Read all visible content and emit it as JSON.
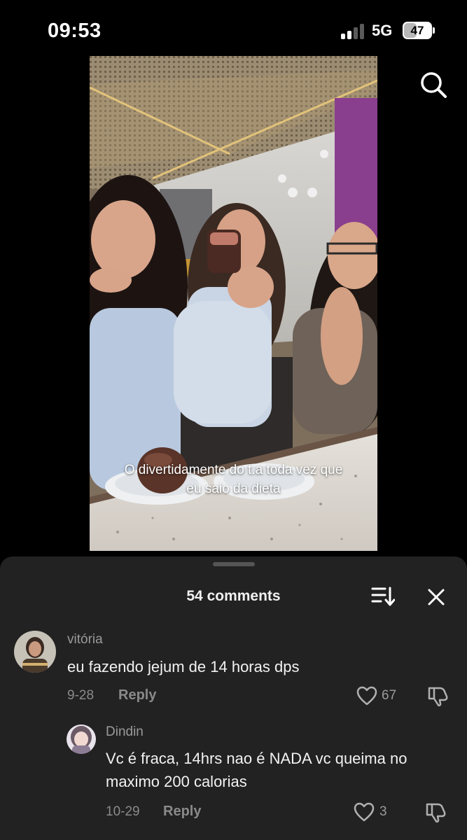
{
  "status_bar": {
    "time": "09:53",
    "network": "5G",
    "battery": "47",
    "battery_level": 0.47
  },
  "video": {
    "caption": "O divertidamente do t.a toda vez que eu saio da dieta"
  },
  "comments_panel": {
    "title": "54 comments",
    "comments": [
      {
        "username": "vitória",
        "text": "eu fazendo jejum de 14 horas dps",
        "date": "9-28",
        "reply_label": "Reply",
        "likes": "67"
      },
      {
        "username": "Dindin",
        "text": "Vc é fraca, 14hrs nao é NADA vc queima no maximo 200 calorias",
        "date": "10-29",
        "reply_label": "Reply",
        "likes": "3"
      }
    ]
  },
  "colors": {
    "background": "#000000",
    "sheet": "#222222",
    "muted_text": "#8a8a8a"
  },
  "icons": [
    "search-icon",
    "sort-icon",
    "close-icon",
    "heart-icon",
    "dislike-icon",
    "signal-icon",
    "battery-icon"
  ]
}
